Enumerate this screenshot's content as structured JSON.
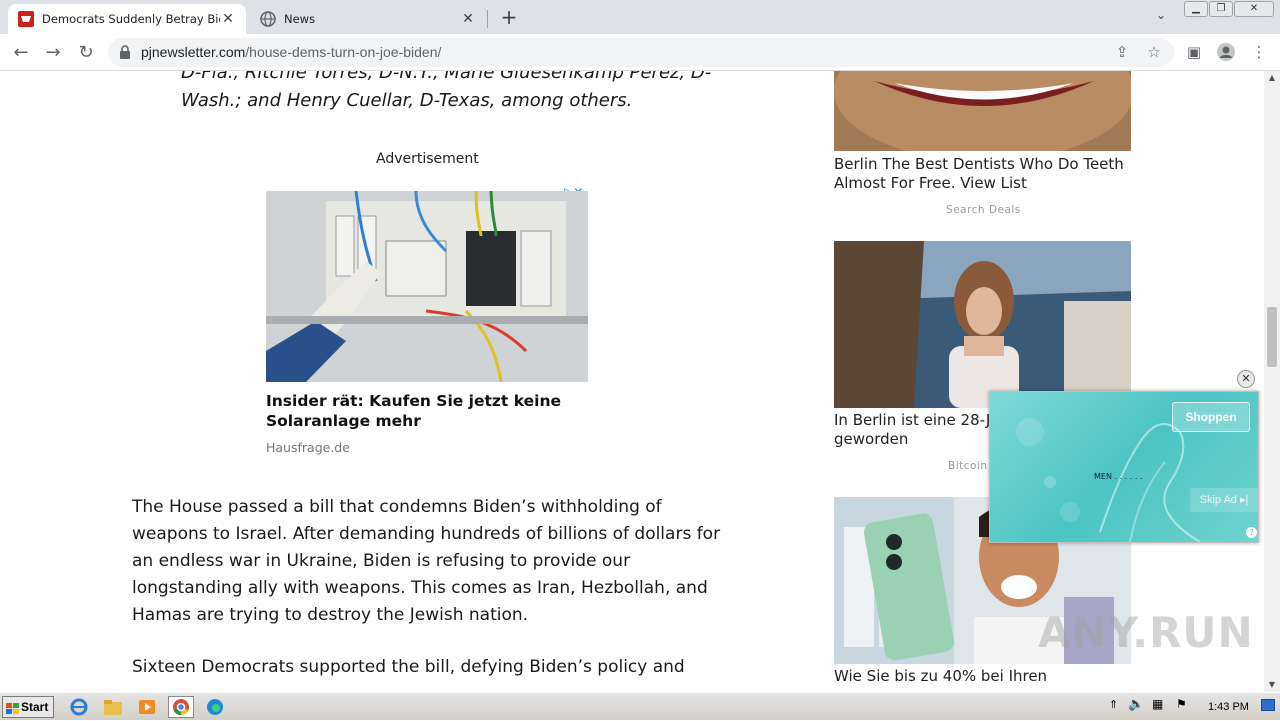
{
  "browser": {
    "tabs": [
      {
        "title": "Democrats Suddenly Betray Biden ov",
        "active": true,
        "icon": "pjnewsletter-favicon"
      },
      {
        "title": "News",
        "active": false,
        "icon": "globe-icon"
      }
    ],
    "url_domain": "pjnewsletter.com",
    "url_path": "/house-dems-turn-on-joe-biden/"
  },
  "article": {
    "quote_line1": "D-Fla., Ritchie Torres, D-N.Y., Marie Gluesenkamp Perez, D-",
    "quote_line2": "Wash.; and Henry Cuellar, D-Texas, among others.",
    "ad_label": "Advertisement",
    "ad_title": "Insider rät: Kaufen Sie jetzt keine Solaranlage mehr",
    "ad_source": "Hausfrage.de",
    "paragraph1": "The House passed a bill that condemns Biden’s withholding of weapons to Israel. After demanding hundreds of billions of dollars for an endless war in Ukraine, Biden is refusing to provide our longstanding ally with weapons. This comes as Iran, Hezbollah, and Hamas are trying to destroy the Jewish nation.",
    "paragraph2": "Sixteen Democrats supported the bill, defying Biden’s policy and"
  },
  "sidebar": {
    "items": [
      {
        "caption": "Berlin The Best Dentists Who Do Teeth Almost For Free. View List",
        "source": "Search Deals"
      },
      {
        "caption": "In Berlin ist eine 28-J Millionärin geworden",
        "source": "Bitcoin"
      },
      {
        "caption": "Wie Sie bis zu 40% bei Ihren",
        "source": ""
      }
    ]
  },
  "video_ad": {
    "cta": "Shoppen",
    "skip": "Skip Ad ▸|",
    "text": "MEN . . . . . ."
  },
  "watermark": "ANY.RUN",
  "taskbar": {
    "start_label": "Start",
    "clock": "1:43 PM"
  }
}
